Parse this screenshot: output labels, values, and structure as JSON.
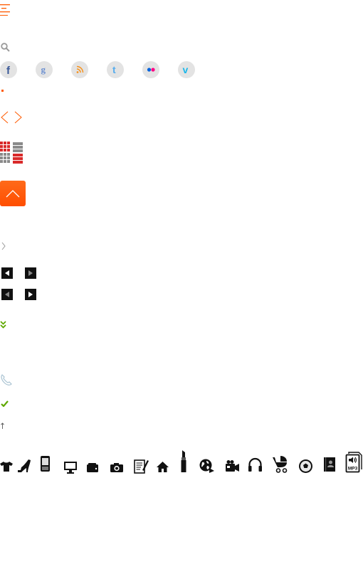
{
  "colors": {
    "accent": "#ff5a00",
    "green": "#5fa800",
    "red": "#d92a2a",
    "gray": "#8a8a8a",
    "black": "#111111"
  },
  "header": {
    "menu_icon": "menu-icon"
  },
  "search": {
    "icon": "search-icon"
  },
  "social_links": [
    {
      "name": "facebook-icon",
      "color": "#3b5998"
    },
    {
      "name": "google-icon",
      "color": "#6b8fd0"
    },
    {
      "name": "rss-icon",
      "color": "#f7931e"
    },
    {
      "name": "twitter-icon",
      "color": "#55acee"
    },
    {
      "name": "flickr-icon",
      "color": "#ff0084"
    },
    {
      "name": "vimeo-icon",
      "color": "#1ab7ea"
    }
  ],
  "arrows": {
    "prev": "chevron-left-icon",
    "next": "chevron-right-icon"
  },
  "view_toggles": {
    "grid": "grid-view-icon",
    "list": "list-view-icon"
  },
  "back_to_top": {
    "icon": "chevron-up-icon"
  },
  "category_icons": [
    "tshirt-icon",
    "high-heel-icon",
    "mobile-phone-icon",
    "monitor-icon",
    "wallet-icon",
    "camera-icon",
    "notepad-icon",
    "home-icon",
    "lipstick-icon",
    "globe-icon",
    "video-camera-icon",
    "headphones-icon",
    "stroller-icon",
    "football-icon",
    "book-icon",
    "mp3-icon"
  ],
  "mp3_label": "MP3"
}
